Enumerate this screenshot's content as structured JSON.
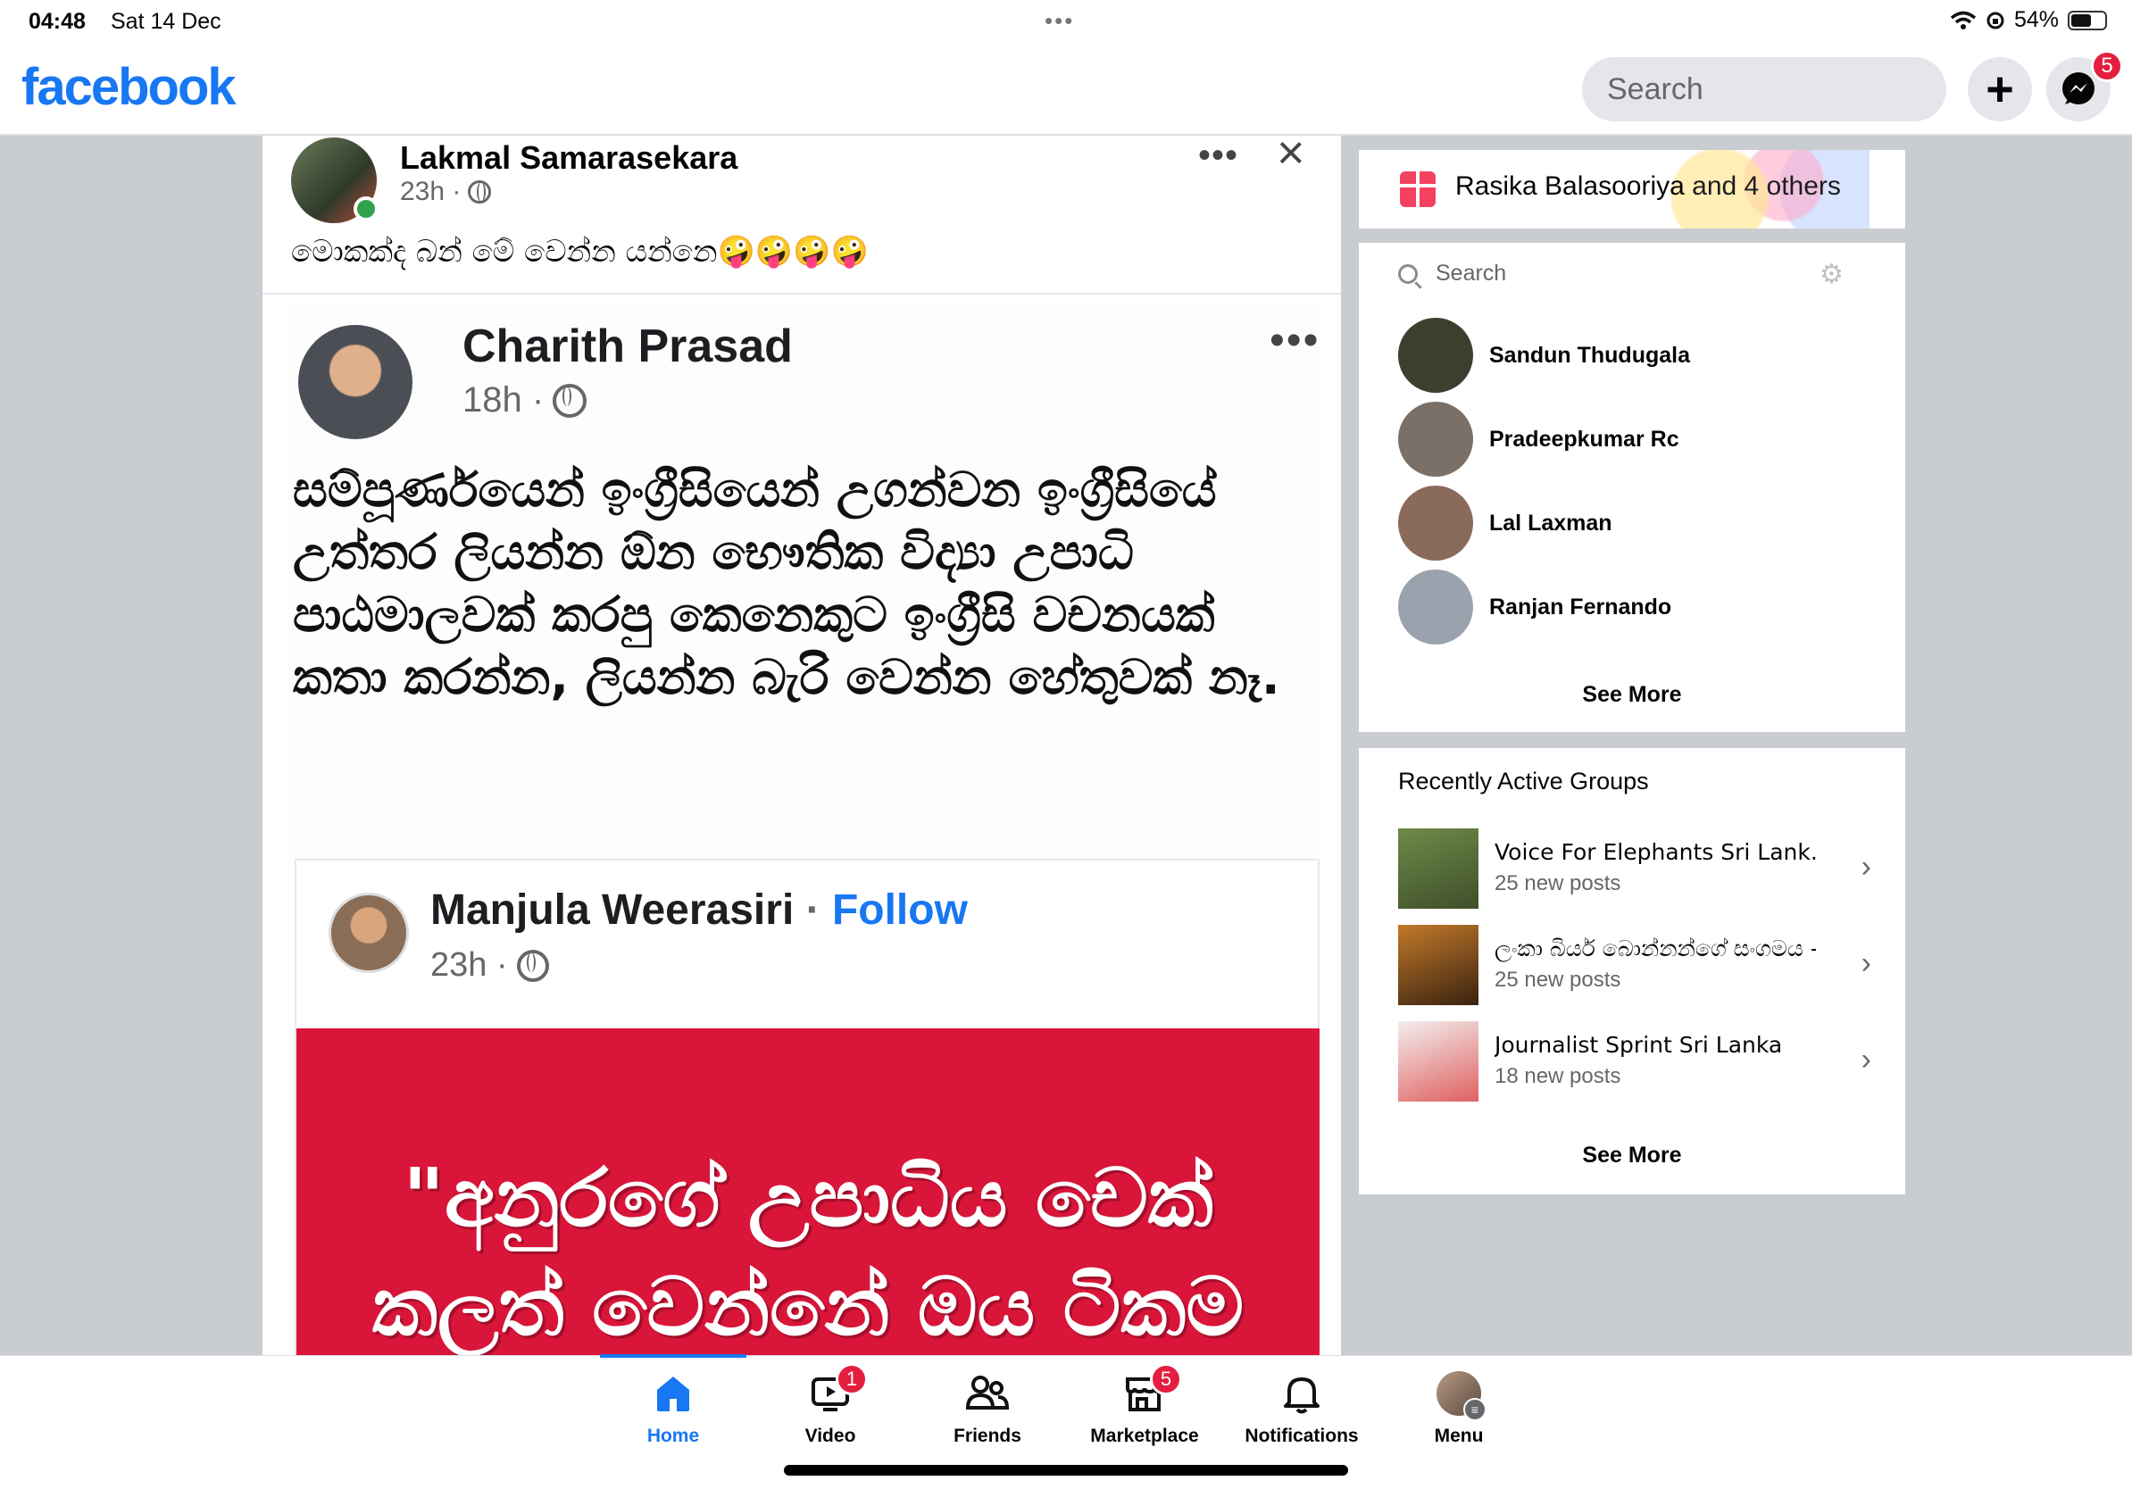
{
  "status_bar": {
    "time": "04:48",
    "date": "Sat 14 Dec",
    "battery": "54%",
    "battery_level": 0.54
  },
  "header": {
    "logo": "facebook",
    "search_placeholder": "Search",
    "messenger_badge": "5"
  },
  "post": {
    "author": "Lakmal Samarasekara",
    "time": "23h · ",
    "caption": "මොකක්ද බන් මේ වෙන්න යන්නෙ🤪🤪🤪🤪",
    "shared": {
      "author": "Charith Prasad",
      "time": "18h · ",
      "text": "සම්පූර්ණයෙන් ඉංග්‍රීසියෙන් උගන්වන ඉංග්‍රීසියේ උත්තර ලියන්න ඕන භෞතික විද්‍යා උපාධි පාඨමාලවක් කරපු කෙනෙකුට ඉංග්‍රීසි වචනයක් කතා කරන්න, ලියන්න බැරි වෙන්න හේතුවක් නෑ.",
      "nested": {
        "author": "Manjula Weerasiri",
        "separator": " · ",
        "follow": "Follow",
        "time": "23h · ",
        "quote": "\"අනුරගේ උපාධිය චෙක් කලත් වෙන්නේ ඔය ටිකම තමා\""
      }
    }
  },
  "birthday": {
    "name": "Rasika Balasooriya",
    "rest": " and 4 others"
  },
  "contacts": {
    "search_placeholder": "Search",
    "items": [
      {
        "name": "Sandun Thudugala",
        "color": "#3a3f2e"
      },
      {
        "name": "Pradeepkumar Rc",
        "color": "#7a7067"
      },
      {
        "name": "Lal Laxman",
        "color": "#8a6a5a"
      },
      {
        "name": "Ranjan Fernando",
        "color": "#9aa3ad"
      }
    ],
    "see_more": "See More"
  },
  "groups": {
    "title": "Recently Active Groups",
    "items": [
      {
        "name": "Voice For Elephants Sri Lank...",
        "sub": "25 new posts",
        "color": "#4d6b3a"
      },
      {
        "name": "ලංකා බියර් බොන්නන්ගේ සංගමය -...",
        "sub": "25 new posts",
        "color": "#8a4a1a"
      },
      {
        "name": "Journalist Sprint Sri Lanka",
        "sub": "18 new posts",
        "color": "#e8e2e2"
      }
    ],
    "see_more": "See More"
  },
  "tabs": [
    {
      "label": "Home"
    },
    {
      "label": "Video",
      "badge": "1"
    },
    {
      "label": "Friends"
    },
    {
      "label": "Marketplace",
      "badge": "5"
    },
    {
      "label": "Notifications"
    },
    {
      "label": "Menu"
    }
  ]
}
